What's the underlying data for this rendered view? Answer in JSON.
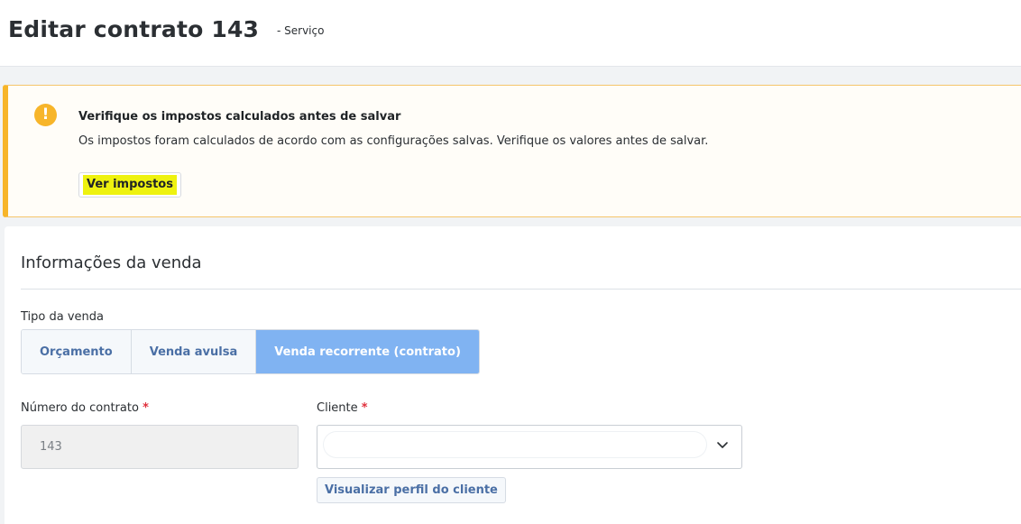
{
  "header": {
    "title": "Editar contrato 143",
    "subtitle": "- Serviço"
  },
  "alert": {
    "icon": "exclamation-icon",
    "icon_glyph": "!",
    "title": "Verifique os impostos calculados antes de salvar",
    "message": "Os impostos foram calculados de acordo com as configurações salvas. Verifique os valores antes de salvar.",
    "button_label": "Ver impostos"
  },
  "section": {
    "title": "Informações da venda",
    "sale_type": {
      "label": "Tipo da venda",
      "options": [
        "Orçamento",
        "Venda avulsa",
        "Venda recorrente (contrato)"
      ],
      "selected": "Venda recorrente (contrato)"
    },
    "contract_number": {
      "label": "Número do contrato",
      "required_mark": "*",
      "value": "143"
    },
    "client": {
      "label": "Cliente",
      "required_mark": "*",
      "value": "",
      "icon": "chevron-down-icon",
      "profile_link": "Visualizar perfil do cliente"
    }
  },
  "colors": {
    "alert_accent": "#f7b52a",
    "segment_active": "#80b3f2",
    "required": "#e0303c",
    "highlight": "#eef20f"
  }
}
